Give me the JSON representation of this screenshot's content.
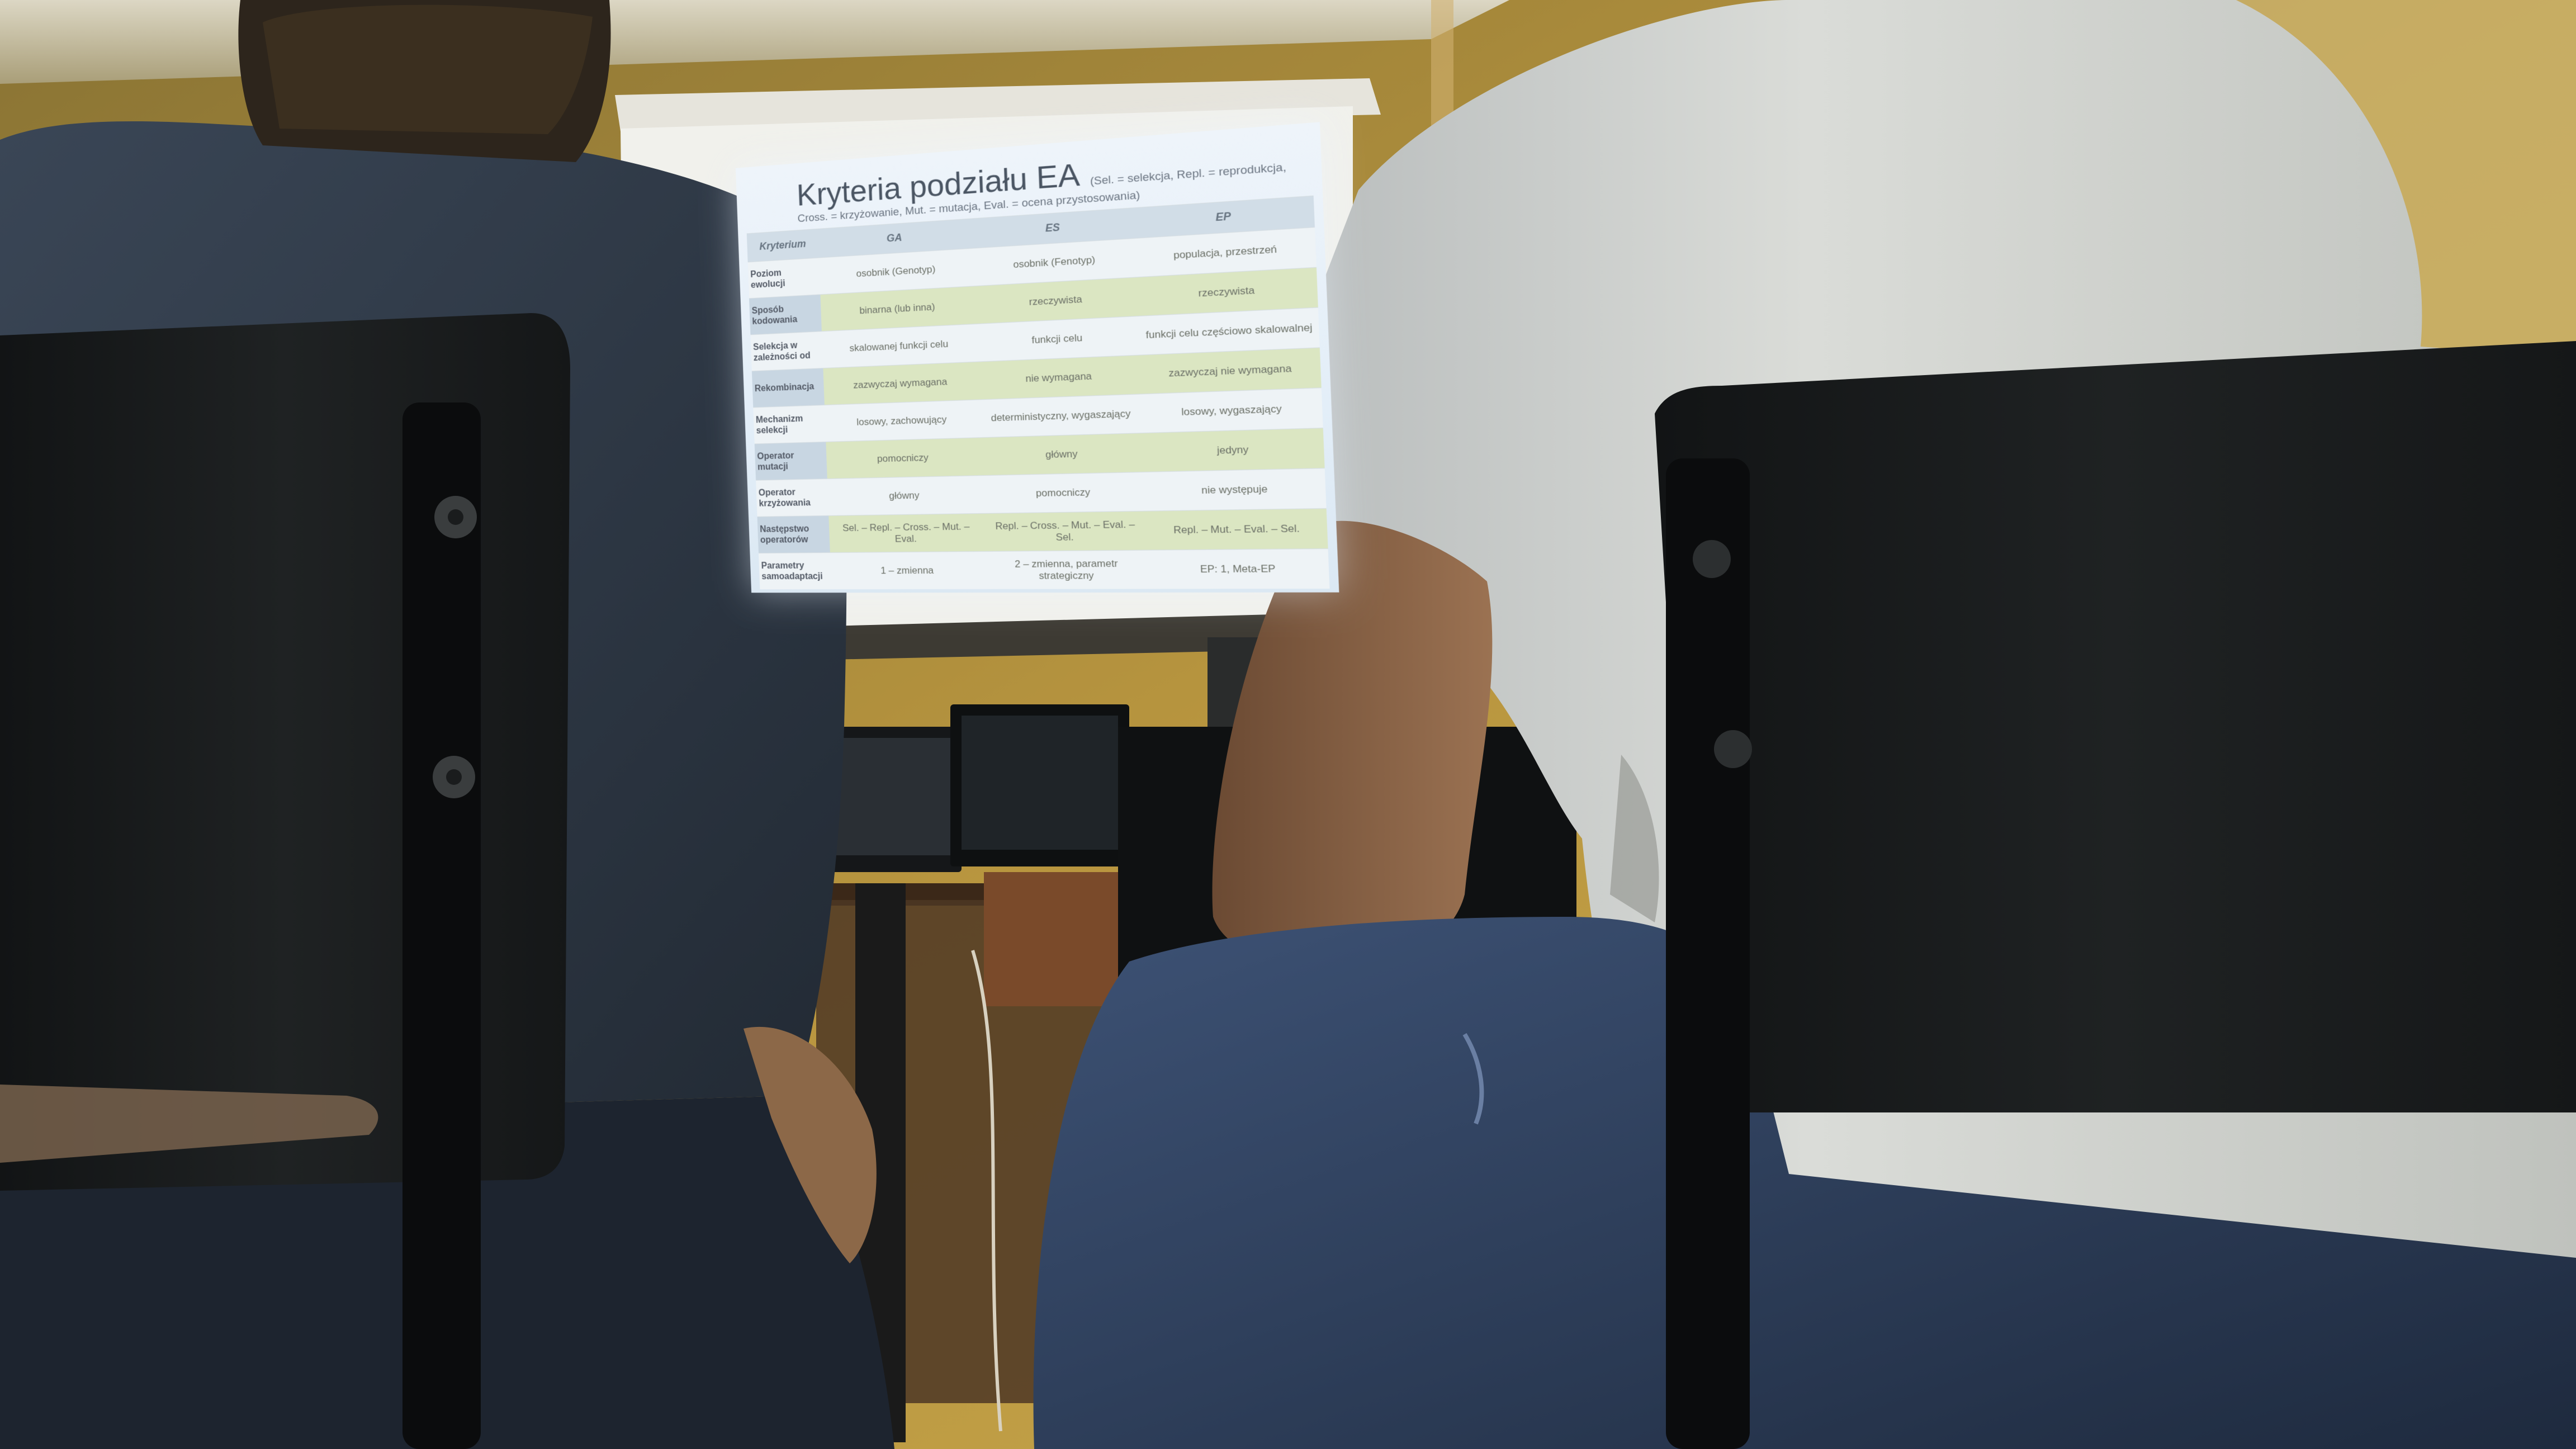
{
  "slide": {
    "title": "Kryteria podziału EA",
    "subtitle_line1": "(Sel. = selekcja, Repl. = reprodukcja,",
    "subtitle_line2": "Cross. = krzyżowanie, Mut. = mutacja, Eval. = ocena przystosowania)",
    "table": {
      "headers": [
        "Kryterium",
        "GA",
        "ES",
        "EP"
      ],
      "rows": [
        [
          "Poziom ewolucji",
          "osobnik (Genotyp)",
          "osobnik (Fenotyp)",
          "populacja, przestrzeń"
        ],
        [
          "Sposób kodowania",
          "binarna (lub inna)",
          "rzeczywista",
          "rzeczywista"
        ],
        [
          "Selekcja w zależności od",
          "skalowanej funkcji celu",
          "funkcji celu",
          "funkcji celu częściowo skalowalnej"
        ],
        [
          "Rekombinacja",
          "zazwyczaj wymagana",
          "nie wymagana",
          "zazwyczaj nie wymagana"
        ],
        [
          "Mechanizm selekcji",
          "losowy, zachowujący",
          "deterministyczny, wygaszający",
          "losowy, wygaszający"
        ],
        [
          "Operator mutacji",
          "pomocniczy",
          "główny",
          "jedyny"
        ],
        [
          "Operator krzyżowania",
          "główny",
          "pomocniczy",
          "nie występuje"
        ],
        [
          "Następstwo operatorów",
          "Sel. – Repl. – Cross. – Mut. – Eval.",
          "Repl. – Cross. – Mut. – Eval. – Sel.",
          "Repl. – Mut. – Eval. – Sel."
        ],
        [
          "Parametry samoadaptacji",
          "1 – zmienna",
          "2 – zmienna, parametr strategiczny",
          "EP: 1, Meta-EP"
        ]
      ]
    }
  },
  "colors": {
    "wall": "#b8943f",
    "screen_glow": "#eef4fa",
    "chair": "#1a1d1e",
    "tshirt": "#d8dad6",
    "jeans": "#2e3f5c",
    "sweater": "#2f3a48"
  }
}
